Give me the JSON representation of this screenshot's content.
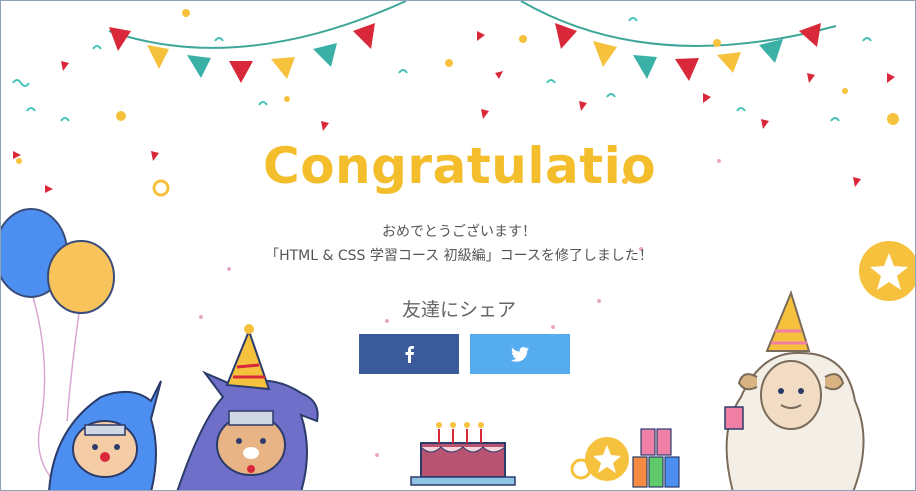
{
  "congrats": {
    "title": "Congratulations",
    "line1": "おめでとうございます！",
    "line2": "「HTML & CSS 学習コース 初級編」コースを修了しました！",
    "share_label": "友達にシェア"
  },
  "share": {
    "facebook": {
      "icon": "facebook-icon",
      "color": "#3b5a9a"
    },
    "twitter": {
      "icon": "twitter-icon",
      "color": "#55acee"
    }
  },
  "colors": {
    "title": "#f3bd2b",
    "flag_red": "#d9283a",
    "flag_yellow": "#f6c23e",
    "flag_teal": "#3bb0a6",
    "confetti_teal": "#45c3b8",
    "balloon_blue": "#4d8ff0",
    "balloon_yellow": "#f7c35a"
  }
}
